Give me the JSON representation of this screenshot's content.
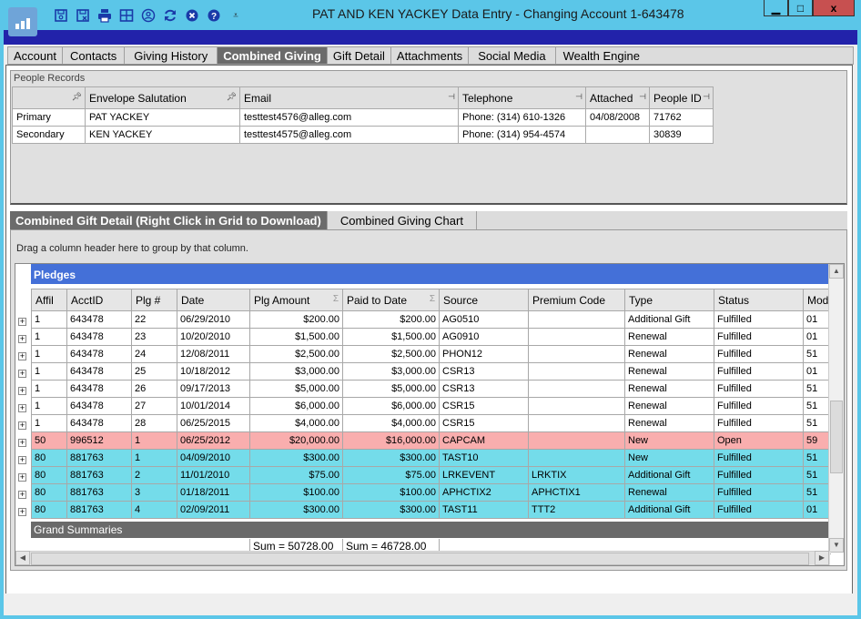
{
  "window": {
    "title": "PAT AND KEN YACKEY Data Entry - Changing Account 1-643478",
    "toolbar": [
      {
        "icon": "save-icon",
        "label": "Save"
      },
      {
        "icon": "save-close-icon",
        "label": "Save and Close"
      },
      {
        "icon": "print-icon",
        "label": "Print"
      },
      {
        "icon": "grid-icon",
        "label": "Layout"
      },
      {
        "icon": "user-icon",
        "label": "User"
      },
      {
        "icon": "refresh-icon",
        "label": "Refresh"
      },
      {
        "icon": "close-circle-icon",
        "label": "Close"
      },
      {
        "icon": "help-icon",
        "label": "Help"
      }
    ],
    "controls": {
      "minimize": "▁",
      "maximize": "□",
      "close": "x"
    }
  },
  "tabs": [
    {
      "label": "Account",
      "active": false
    },
    {
      "label": "Contacts",
      "active": false
    },
    {
      "label": "Giving History",
      "active": false
    },
    {
      "label": "Combined Giving",
      "active": true
    },
    {
      "label": "Gift Detail",
      "active": false
    },
    {
      "label": "Attachments",
      "active": false
    },
    {
      "label": "Social Media",
      "active": false
    },
    {
      "label": "Wealth Engine",
      "active": false
    }
  ],
  "people_records": {
    "label": "People Records",
    "columns": [
      "",
      "Envelope Salutation",
      "Email",
      "Telephone",
      "Attached",
      "People ID"
    ],
    "rows": [
      [
        "Primary",
        "PAT YACKEY",
        "testtest4576@alleg.com",
        "Phone: (314) 610-1326",
        "04/08/2008",
        "71762"
      ],
      [
        "Secondary",
        "KEN YACKEY",
        "testtest4575@alleg.com",
        "Phone: (314) 954-4574",
        "",
        "30839"
      ]
    ]
  },
  "lower_tabs": [
    {
      "label": "Combined Gift Detail (Right Click in Grid to Download)",
      "active": true
    },
    {
      "label": "Combined Giving Chart",
      "active": false
    }
  ],
  "grid": {
    "group_hint": "Drag a column header here to group by that column.",
    "band": "Pledges",
    "columns": [
      "Affil",
      "AcctID",
      "Plg #",
      "Date",
      "Plg Amount",
      "Paid to Date",
      "Source",
      "Premium Code",
      "Type",
      "Status",
      "Mode"
    ],
    "rows": [
      {
        "style": "white",
        "cells": [
          "1",
          "643478",
          "22",
          "06/29/2010",
          "$200.00",
          "$200.00",
          "AG0510",
          "",
          "Additional Gift",
          "Fulfilled",
          "01"
        ]
      },
      {
        "style": "white",
        "cells": [
          "1",
          "643478",
          "23",
          "10/20/2010",
          "$1,500.00",
          "$1,500.00",
          "AG0910",
          "",
          "Renewal",
          "Fulfilled",
          "01"
        ]
      },
      {
        "style": "white",
        "cells": [
          "1",
          "643478",
          "24",
          "12/08/2011",
          "$2,500.00",
          "$2,500.00",
          "PHON12",
          "",
          "Renewal",
          "Fulfilled",
          "51"
        ]
      },
      {
        "style": "white",
        "cells": [
          "1",
          "643478",
          "25",
          "10/18/2012",
          "$3,000.00",
          "$3,000.00",
          "CSR13",
          "",
          "Renewal",
          "Fulfilled",
          "01"
        ]
      },
      {
        "style": "white",
        "cells": [
          "1",
          "643478",
          "26",
          "09/17/2013",
          "$5,000.00",
          "$5,000.00",
          "CSR13",
          "",
          "Renewal",
          "Fulfilled",
          "51"
        ]
      },
      {
        "style": "white",
        "cells": [
          "1",
          "643478",
          "27",
          "10/01/2014",
          "$6,000.00",
          "$6,000.00",
          "CSR15",
          "",
          "Renewal",
          "Fulfilled",
          "51"
        ]
      },
      {
        "style": "white",
        "cells": [
          "1",
          "643478",
          "28",
          "06/25/2015",
          "$4,000.00",
          "$4,000.00",
          "CSR15",
          "",
          "Renewal",
          "Fulfilled",
          "51"
        ]
      },
      {
        "style": "red",
        "cells": [
          "50",
          "996512",
          "1",
          "06/25/2012",
          "$20,000.00",
          "$16,000.00",
          "CAPCAM",
          "",
          "New",
          "Open",
          "59"
        ]
      },
      {
        "style": "cyan",
        "cells": [
          "80",
          "881763",
          "1",
          "04/09/2010",
          "$300.00",
          "$300.00",
          "TAST10",
          "",
          "New",
          "Fulfilled",
          "51"
        ]
      },
      {
        "style": "cyan",
        "cells": [
          "80",
          "881763",
          "2",
          "11/01/2010",
          "$75.00",
          "$75.00",
          "LRKEVENT",
          "LRKTIX",
          "Additional Gift",
          "Fulfilled",
          "51"
        ]
      },
      {
        "style": "cyan",
        "cells": [
          "80",
          "881763",
          "3",
          "01/18/2011",
          "$100.00",
          "$100.00",
          "APHCTIX2",
          "APHCTIX1",
          "Renewal",
          "Fulfilled",
          "51"
        ]
      },
      {
        "style": "cyan",
        "cells": [
          "80",
          "881763",
          "4",
          "02/09/2011",
          "$300.00",
          "$300.00",
          "TAST11",
          "TTT2",
          "Additional Gift",
          "Fulfilled",
          "01"
        ]
      }
    ],
    "grand_summaries": {
      "label": "Grand Summaries",
      "plg_amount_sum": "Sum = 50728.00",
      "paid_to_date_sum": "Sum = 46728.00"
    }
  },
  "colors": {
    "title_bar": "#5bc6e8",
    "band_header": "#4470d8",
    "active_tab": "#6b6b6b",
    "row_red": "#f9aeae",
    "row_cyan": "#74dcea"
  }
}
